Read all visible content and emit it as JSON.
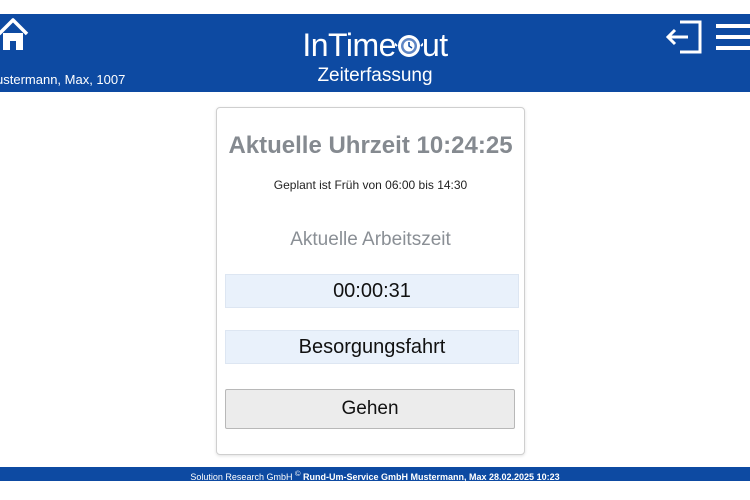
{
  "header": {
    "app_name_pre": "InTime",
    "app_name_post": "ut",
    "subtitle": "Zeiterfassung",
    "user": "ustermann, Max, 1007",
    "icons": {
      "home": "home-icon",
      "logout": "logout-icon",
      "menu": "hamburger-menu-icon",
      "logo": "clock-logo-icon"
    }
  },
  "main": {
    "current_time": "Aktuelle Uhrzeit 10:24:25",
    "plan": "Geplant ist Früh von 06:00 bis 14:30",
    "worktime_label": "Aktuelle Arbeitszeit",
    "worktime_value": "00:00:31",
    "activity": "Besorgungsfahrt",
    "go_button": "Gehen"
  },
  "footer": {
    "company": "Solution Research GmbH ",
    "copyright": "©",
    "info": " Rund-Um-Service GmbH Mustermann, Max 28.02.2025 10:23"
  },
  "colors": {
    "brand_blue": "#0d4aa2",
    "field_bg": "#e9f1fb",
    "title_gray": "#858a90"
  }
}
